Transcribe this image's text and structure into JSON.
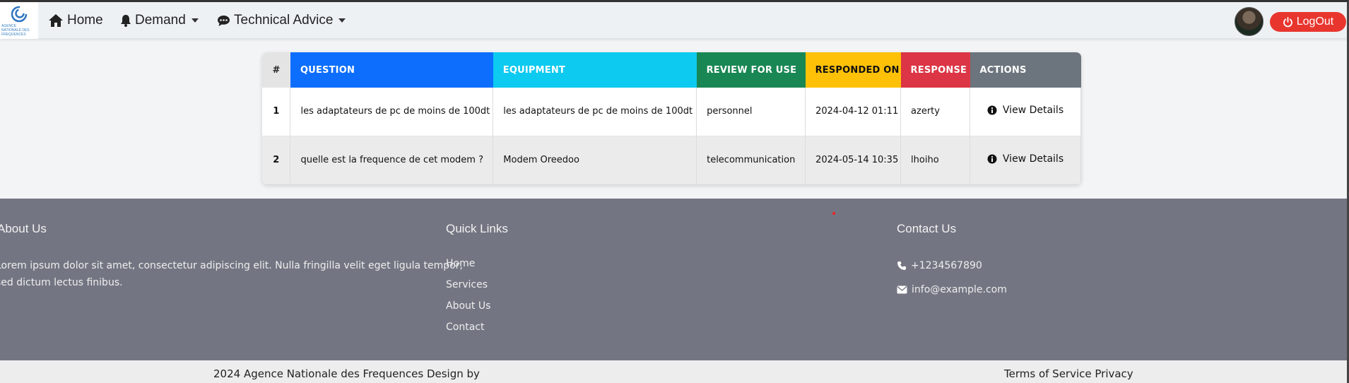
{
  "nav": {
    "logo_text": "AGENCE NATIONALE DES FREQUENCES",
    "home": "Home",
    "demand": "Demand",
    "technical_advice": "Technical Advice",
    "logout": "LogOut",
    "colors": {
      "logout_bg": "#e8362f"
    }
  },
  "table": {
    "headers": [
      "#",
      "QUESTION",
      "EQUIPMENT",
      "REVIEW FOR USE",
      "RESPONDED ON",
      "RESPONSE",
      "ACTIONS"
    ],
    "header_colors": [
      "#e4e4e4",
      "#0d6efd",
      "#0dcaf0",
      "#198754",
      "#ffc107",
      "#dc3545",
      "#6c757d"
    ],
    "rows": [
      {
        "num": "1",
        "question": "les adaptateurs de pc de moins de 100dt",
        "equipment": "les adaptateurs de pc de moins de 100dt",
        "review": "personnel",
        "responded_on": "2024-04-12 01:11",
        "response": "azerty",
        "action": "View Details"
      },
      {
        "num": "2",
        "question": "quelle est la frequence de cet modem ?",
        "equipment": "Modem Oreedoo",
        "review": "telecommunication",
        "responded_on": "2024-05-14 10:35",
        "response": "lhoiho",
        "action": "View Details"
      }
    ]
  },
  "footer": {
    "about_title": "About Us",
    "about_text_1": "Lorem ipsum dolor sit amet, consectetur adipiscing elit. Nulla fringilla velit eget ligula tempor,",
    "about_text_2": "sed dictum lectus finibus.",
    "links_title": "Quick Links",
    "links": [
      "Home",
      "Services",
      "About Us",
      "Contact"
    ],
    "contact_title": "Contact Us",
    "phone": "+1234567890",
    "email": "info@example.com"
  },
  "bottom": {
    "copyright": "2024 Agence Nationale des Frequences Design by",
    "terms": "Terms of Service Privacy"
  }
}
